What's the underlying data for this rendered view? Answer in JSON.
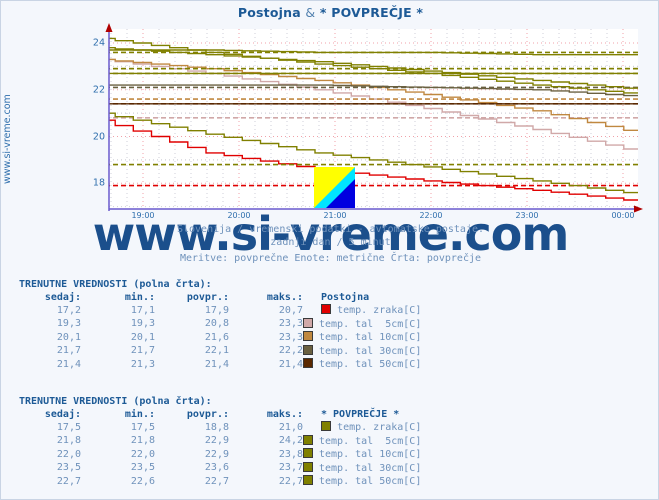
{
  "page": {
    "site_label": "www.si-vreme.com",
    "watermark": "www.si-vreme.com",
    "background": "#f4f7fc"
  },
  "header": {
    "title_station": "Postojna",
    "title_sep": "&",
    "title_average": "* POVPREČJE *"
  },
  "subtitle": {
    "line1": "Slovenija / vremenski podatki - avtomatske postaje.",
    "line2": "zadnji dan / 5 minut",
    "line3": "Meritve: povprečne  Enote: metrične  Črta: povprečje"
  },
  "logo": {
    "name": "si-vreme-logo",
    "color_top": "#ffff00",
    "color_mid": "#00e5ff",
    "color_bottom": "#0000e0"
  },
  "chart_data": {
    "type": "line",
    "title": "Postojna & * POVPREČJE *",
    "xlabel": "",
    "ylabel": "",
    "grid": true,
    "legend_position": "below",
    "ylim": [
      16.9,
      24.6
    ],
    "yticks": [
      18,
      20,
      22,
      24
    ],
    "ytick_labels": [
      "18",
      "20",
      "22",
      "24"
    ],
    "x": [
      "19:00",
      "20:00",
      "21:00",
      "22:00",
      "23:00",
      "00:00"
    ],
    "xtick_labels": [
      "19:00",
      "20:00",
      "21:00",
      "22:00",
      "23:00",
      "00:00"
    ],
    "xlim_start": "18:40",
    "xlim_end": "00:25",
    "series": [
      {
        "name": "Postojna temp. zraka[C]",
        "color": "#e00000",
        "style": "solid",
        "values": [
          20.7,
          19.3,
          18.6,
          18.1,
          17.7,
          17.2
        ]
      },
      {
        "name": "Postojna temp. zraka[C] povprecje",
        "color": "#e00000",
        "style": "dashed",
        "values": [
          17.9,
          17.9,
          17.9,
          17.9,
          17.9,
          17.9
        ]
      },
      {
        "name": "Postojna temp. tal 5cm[C]",
        "color": "#d0a8a8",
        "style": "solid",
        "values": [
          23.3,
          22.7,
          22.0,
          21.2,
          20.3,
          19.3
        ]
      },
      {
        "name": "Postojna temp. tal 5cm[C] povprecje",
        "color": "#d0a8a8",
        "style": "dashed",
        "values": [
          20.8,
          20.8,
          20.8,
          20.8,
          20.8,
          20.8
        ]
      },
      {
        "name": "Postojna temp. tal 10cm[C]",
        "color": "#c08840",
        "style": "solid",
        "values": [
          23.3,
          22.9,
          22.4,
          21.8,
          21.1,
          20.1
        ]
      },
      {
        "name": "Postojna temp. tal 10cm[C] povprecje",
        "color": "#c08840",
        "style": "dashed",
        "values": [
          21.6,
          21.6,
          21.6,
          21.6,
          21.6,
          21.6
        ]
      },
      {
        "name": "Postojna temp. tal 30cm[C]",
        "color": "#6a6040",
        "style": "solid",
        "values": [
          22.2,
          22.2,
          22.2,
          22.1,
          22.0,
          21.7
        ]
      },
      {
        "name": "Postojna temp. tal 30cm[C] povprecje",
        "color": "#6a6040",
        "style": "dashed",
        "values": [
          22.1,
          22.1,
          22.1,
          22.1,
          22.1,
          22.1
        ]
      },
      {
        "name": "Postojna temp. tal 50cm[C]",
        "color": "#5a2800",
        "style": "solid",
        "values": [
          21.4,
          21.4,
          21.4,
          21.4,
          21.4,
          21.4
        ]
      },
      {
        "name": "Postojna temp. tal 50cm[C] povprecje",
        "color": "#5a2800",
        "style": "dashed",
        "values": [
          21.4,
          21.4,
          21.4,
          21.4,
          21.4,
          21.4
        ]
      },
      {
        "name": "* POVPREČJE * temp. zraka[C]",
        "color": "#808000",
        "style": "solid",
        "values": [
          21.0,
          20.1,
          19.3,
          18.7,
          18.1,
          17.5
        ]
      },
      {
        "name": "* POVPREČJE * temp. zraka[C] povprecje",
        "color": "#808000",
        "style": "dashed",
        "values": [
          18.8,
          18.8,
          18.8,
          18.8,
          18.8,
          18.8
        ]
      },
      {
        "name": "* POVPREČJE * temp. tal 5cm[C]",
        "color": "#808000",
        "style": "solid",
        "values": [
          24.2,
          23.6,
          23.1,
          22.7,
          22.2,
          21.8
        ]
      },
      {
        "name": "* POVPREČJE * temp. tal 5cm[C] povprecje",
        "color": "#808000",
        "style": "dashed",
        "values": [
          22.9,
          22.9,
          22.9,
          22.9,
          22.9,
          22.9
        ]
      },
      {
        "name": "* POVPREČJE * temp. tal 10cm[C]",
        "color": "#808000",
        "style": "solid",
        "values": [
          23.8,
          23.5,
          23.2,
          22.8,
          22.4,
          22.0
        ]
      },
      {
        "name": "* POVPREČJE * temp. tal 10cm[C] povprecje",
        "color": "#808000",
        "style": "dashed",
        "values": [
          22.9,
          22.9,
          22.9,
          22.9,
          22.9,
          22.9
        ]
      },
      {
        "name": "* POVPREČJE * temp. tal 30cm[C]",
        "color": "#808000",
        "style": "solid",
        "values": [
          23.7,
          23.7,
          23.6,
          23.6,
          23.5,
          23.5
        ]
      },
      {
        "name": "* POVPREČJE * temp. tal 30cm[C] povprecje",
        "color": "#808000",
        "style": "dashed",
        "values": [
          23.6,
          23.6,
          23.6,
          23.6,
          23.6,
          23.6
        ]
      },
      {
        "name": "* POVPREČJE * temp. tal 50cm[C]",
        "color": "#808000",
        "style": "solid",
        "values": [
          22.7,
          22.7,
          22.7,
          22.7,
          22.7,
          22.7
        ]
      },
      {
        "name": "* POVPREČJE * temp. tal 50cm[C] povprecje",
        "color": "#808000",
        "style": "dashed",
        "values": [
          22.7,
          22.7,
          22.7,
          22.7,
          22.7,
          22.7
        ]
      }
    ]
  },
  "tables": [
    {
      "id": "station",
      "heading": "TRENUTNE VREDNOSTI (polna črta):",
      "columns": [
        "sedaj:",
        "min.:",
        "povpr.:",
        "maks.:"
      ],
      "group_label": "Postojna",
      "rows": [
        {
          "sedaj": "17,2",
          "min": "17,1",
          "povpr": "17,9",
          "maks": "20,7",
          "color": "#e00000",
          "label": "temp. zraka[C]"
        },
        {
          "sedaj": "19,3",
          "min": "19,3",
          "povpr": "20,8",
          "maks": "23,3",
          "color": "#d0a8a8",
          "label": "temp. tal  5cm[C]"
        },
        {
          "sedaj": "20,1",
          "min": "20,1",
          "povpr": "21,6",
          "maks": "23,3",
          "color": "#c08840",
          "label": "temp. tal 10cm[C]"
        },
        {
          "sedaj": "21,7",
          "min": "21,7",
          "povpr": "22,1",
          "maks": "22,2",
          "color": "#6a6040",
          "label": "temp. tal 30cm[C]"
        },
        {
          "sedaj": "21,4",
          "min": "21,3",
          "povpr": "21,4",
          "maks": "21,4",
          "color": "#5a2800",
          "label": "temp. tal 50cm[C]"
        }
      ]
    },
    {
      "id": "average",
      "heading": "TRENUTNE VREDNOSTI (polna črta):",
      "columns": [
        "sedaj:",
        "min.:",
        "povpr.:",
        "maks.:"
      ],
      "group_label": "* POVPREČJE *",
      "rows": [
        {
          "sedaj": "17,5",
          "min": "17,5",
          "povpr": "18,8",
          "maks": "21,0",
          "color": "#808000",
          "label": "temp. zraka[C]"
        },
        {
          "sedaj": "21,8",
          "min": "21,8",
          "povpr": "22,9",
          "maks": "24,2",
          "color": "#808000",
          "label": "temp. tal  5cm[C]"
        },
        {
          "sedaj": "22,0",
          "min": "22,0",
          "povpr": "22,9",
          "maks": "23,8",
          "color": "#808000",
          "label": "temp. tal 10cm[C]"
        },
        {
          "sedaj": "23,5",
          "min": "23,5",
          "povpr": "23,6",
          "maks": "23,7",
          "color": "#808000",
          "label": "temp. tal 30cm[C]"
        },
        {
          "sedaj": "22,7",
          "min": "22,6",
          "povpr": "22,7",
          "maks": "22,7",
          "color": "#808000",
          "label": "temp. tal 50cm[C]"
        }
      ]
    }
  ]
}
